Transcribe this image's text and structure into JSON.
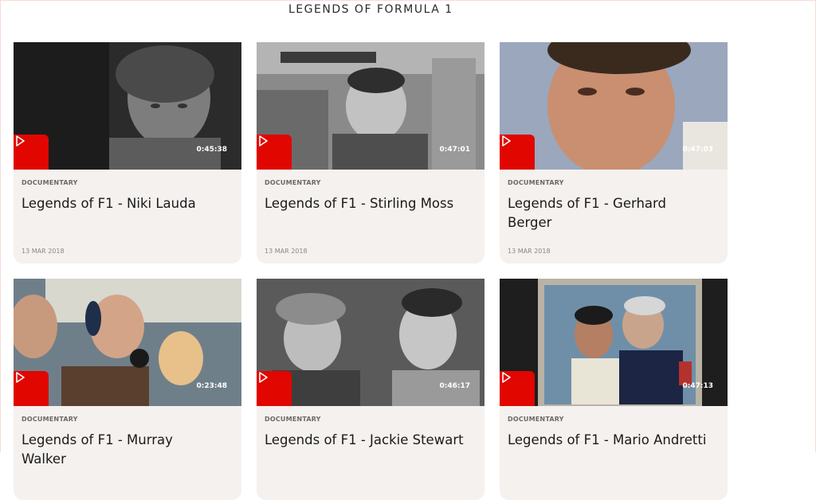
{
  "section": {
    "title": "LEGENDS OF FORMULA 1"
  },
  "cards": [
    {
      "category": "DOCUMENTARY",
      "title": "Legends of F1 - Niki Lauda",
      "date": "13 MAR 2018",
      "duration": "0:45:38"
    },
    {
      "category": "DOCUMENTARY",
      "title": "Legends of F1 - Stirling Moss",
      "date": "13 MAR 2018",
      "duration": "0:47:01"
    },
    {
      "category": "DOCUMENTARY",
      "title": "Legends of F1 - Gerhard Berger",
      "date": "13 MAR 2018",
      "duration": "0:47:03"
    },
    {
      "category": "DOCUMENTARY",
      "title": "Legends of F1 - Murray Walker",
      "date": "",
      "duration": "0:23:48"
    },
    {
      "category": "DOCUMENTARY",
      "title": "Legends of F1 - Jackie Stewart",
      "date": "",
      "duration": "0:46:17"
    },
    {
      "category": "DOCUMENTARY",
      "title": "Legends of F1 - Mario Andretti",
      "date": "",
      "duration": "0:47:13"
    }
  ],
  "colors": {
    "accent": "#e10600",
    "card_bg": "#f5f1ee"
  },
  "icons": {
    "play": "play-icon"
  }
}
